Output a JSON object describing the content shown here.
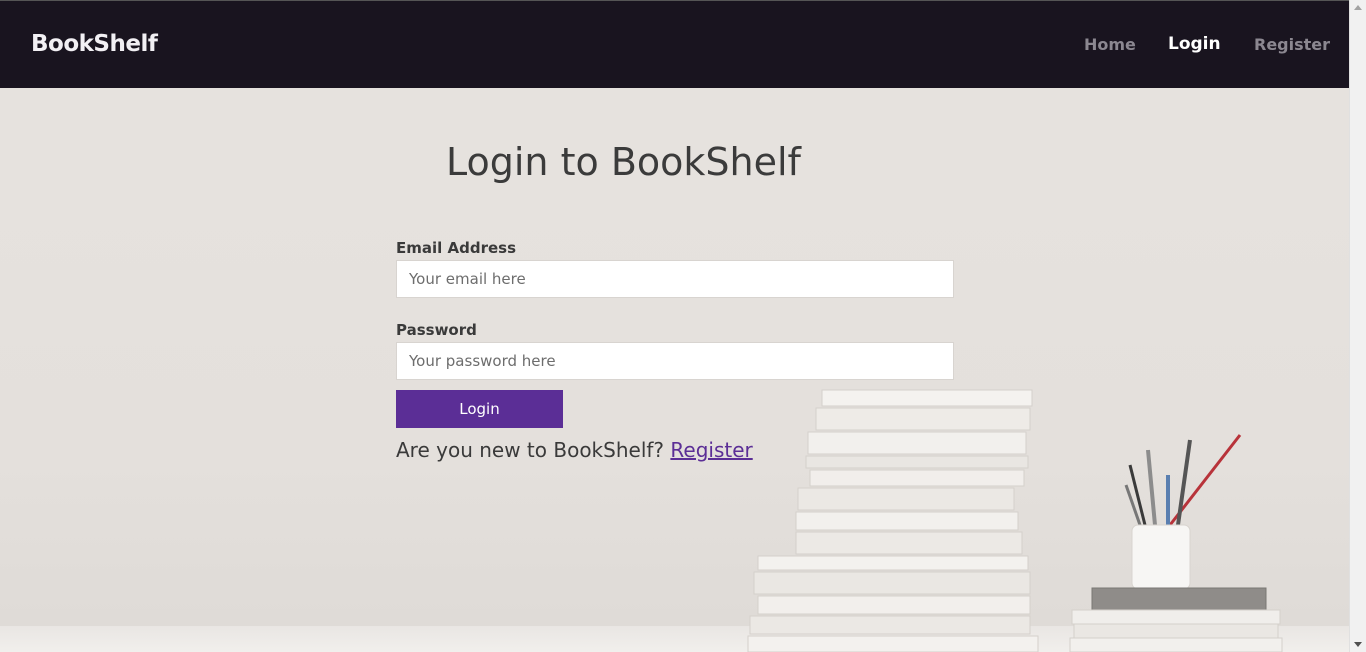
{
  "navbar": {
    "brand": "BookShelf",
    "links": [
      {
        "label": "Home",
        "active": false
      },
      {
        "label": "Login",
        "active": true
      },
      {
        "label": "Register",
        "active": false
      }
    ]
  },
  "page": {
    "title": "Login to BookShelf"
  },
  "form": {
    "email": {
      "label": "Email Address",
      "placeholder": "Your email here",
      "value": ""
    },
    "password": {
      "label": "Password",
      "placeholder": "Your password here",
      "value": ""
    },
    "submit_label": "Login",
    "register_prompt": "Are you new to BookShelf?",
    "register_link": "Register"
  },
  "colors": {
    "navbar_bg": "#19141f",
    "accent": "#5b2e96",
    "page_bg": "#e6e2de"
  }
}
